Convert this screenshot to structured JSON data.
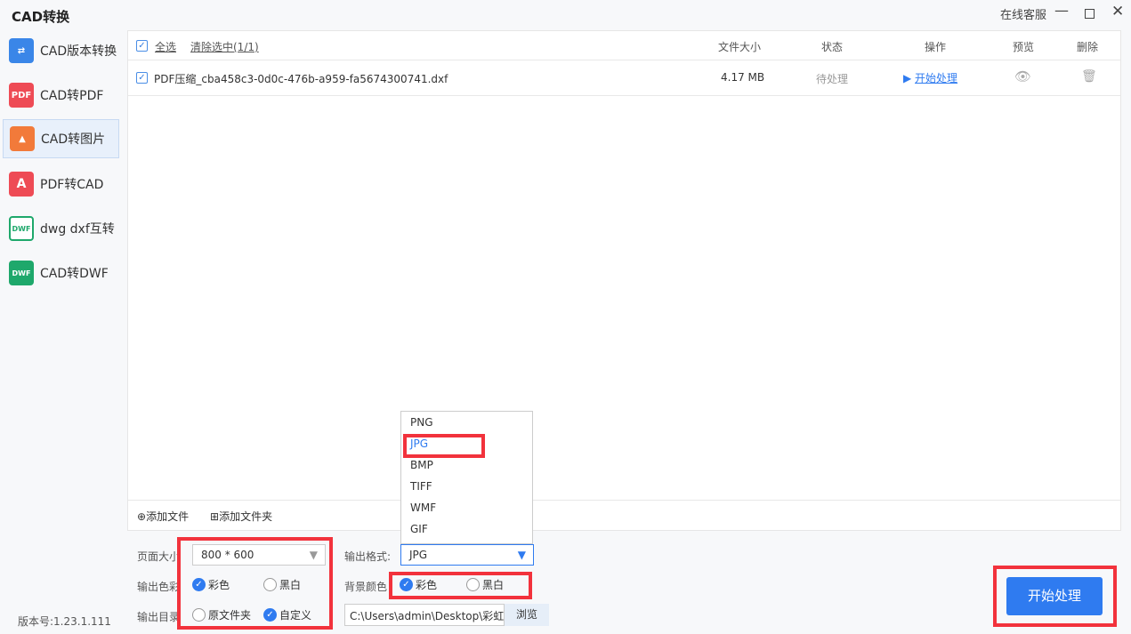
{
  "app": {
    "title": "CAD转换",
    "support": "在线客服",
    "version": "版本号:1.23.1.111"
  },
  "sidebar": {
    "items": [
      {
        "label": "CAD版本转换",
        "icon": "swap-icon",
        "color": "#3a86e8"
      },
      {
        "label": "CAD转PDF",
        "icon": "pdf-icon",
        "color": "#ee4b55"
      },
      {
        "label": "CAD转图片",
        "icon": "image-icon",
        "color": "#f27a3a",
        "active": true
      },
      {
        "label": "PDF转CAD",
        "icon": "pdf-to-cad-icon",
        "color": "#ee4b55"
      },
      {
        "label": "dwg dxf互转",
        "icon": "dwf-convert-icon",
        "color": "#1ea86b"
      },
      {
        "label": "CAD转DWF",
        "icon": "dwf-icon",
        "color": "#1ea86b"
      }
    ]
  },
  "table": {
    "select_all": "全选",
    "clear": "清除选中(1/1)",
    "headers": {
      "size": "文件大小",
      "status": "状态",
      "action": "操作",
      "preview": "预览",
      "delete": "删除"
    },
    "rows": [
      {
        "name": "PDF压缩_cba458c3-0d0c-476b-a959-fa5674300741.dxf",
        "size": "4.17 MB",
        "status": "待处理",
        "action": "开始处理",
        "checked": true
      }
    ]
  },
  "footer": {
    "add_file": "添加文件",
    "add_folder": "添加文件夹"
  },
  "options": {
    "page_size_label": "页面大小",
    "page_size": "800 * 600",
    "color_label": "输出色彩",
    "color_opts": [
      "彩色",
      "黑白"
    ],
    "dir_label": "输出目录",
    "dir_opts": [
      "原文件夹",
      "自定义"
    ],
    "format_label": "输出格式:",
    "format": "JPG",
    "format_options": [
      "PNG",
      "JPG",
      "BMP",
      "TIFF",
      "WMF",
      "GIF"
    ],
    "bg_label": "背景颜色",
    "bg_opts": [
      "彩色",
      "黑白"
    ],
    "path": "C:\\Users\\admin\\Desktop\\彩虹",
    "browse": "浏览"
  },
  "start": "开始处理",
  "colors": {
    "accent": "#2f7bf0",
    "highlight": "#f2323c"
  }
}
